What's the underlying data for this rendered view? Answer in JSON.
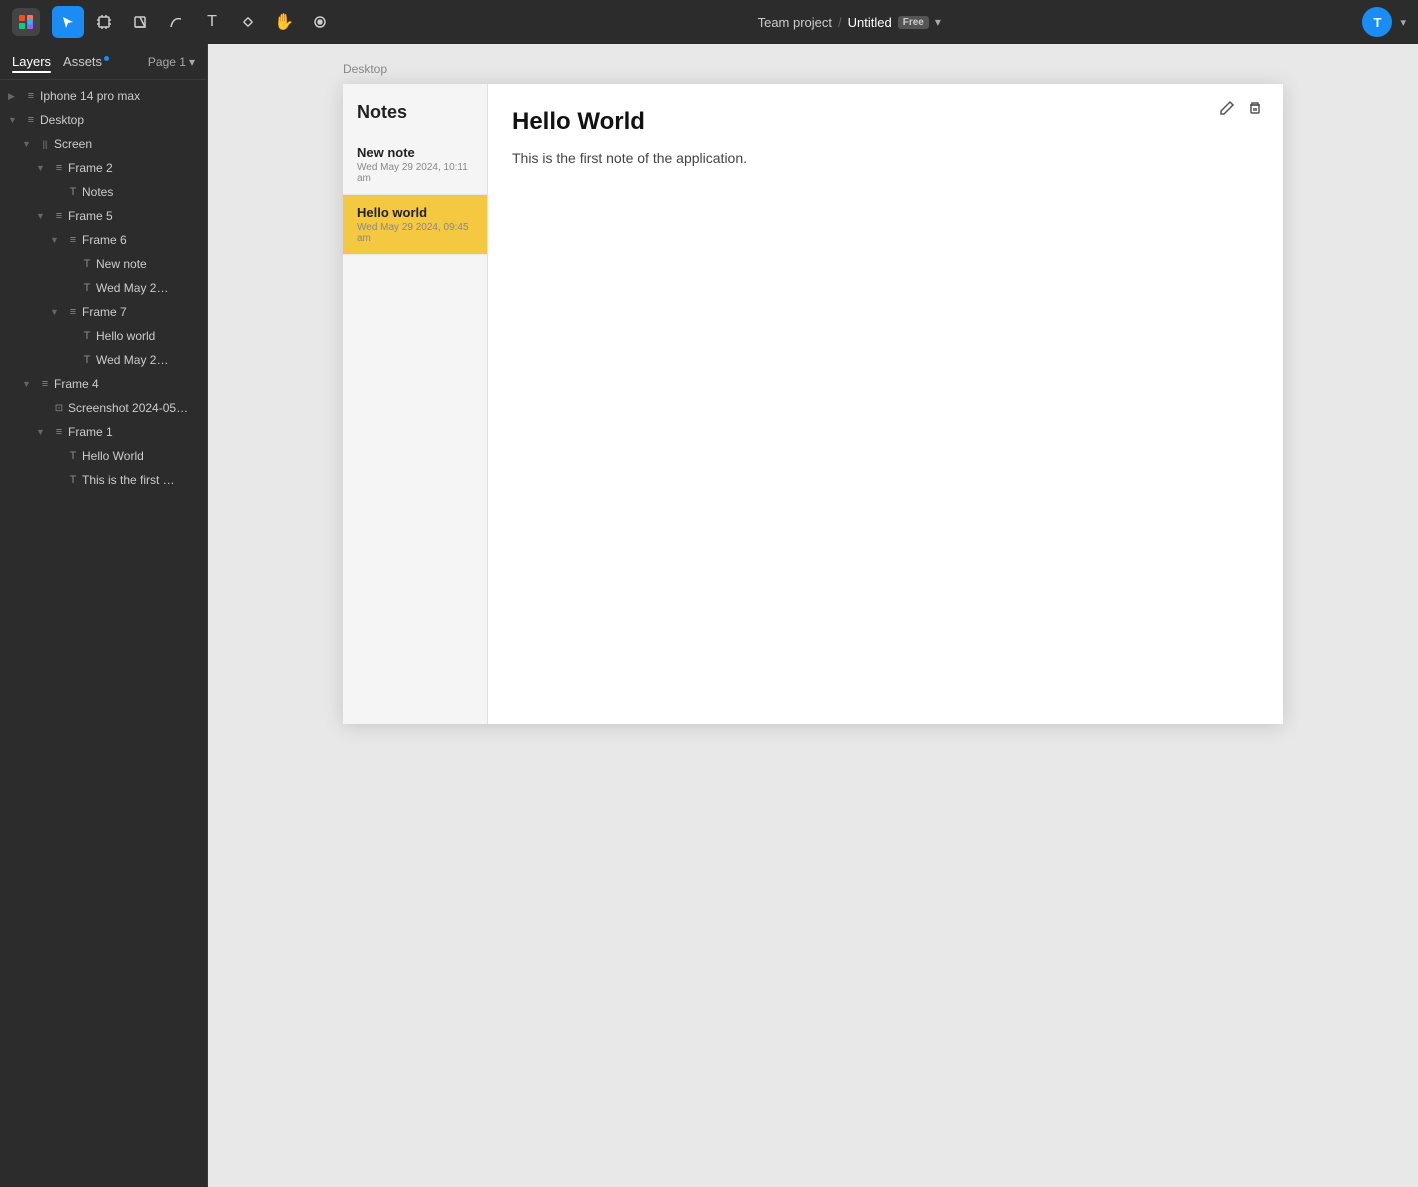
{
  "topbar": {
    "logo_icon": "figma-icon",
    "tools": [
      {
        "id": "select",
        "label": "Select",
        "icon": "▶",
        "active": true
      },
      {
        "id": "frame",
        "label": "Frame",
        "icon": "⊞",
        "active": false
      },
      {
        "id": "shape",
        "label": "Shape",
        "icon": "□",
        "active": false
      },
      {
        "id": "vector",
        "label": "Vector",
        "icon": "✏",
        "active": false
      },
      {
        "id": "text",
        "label": "Text",
        "icon": "T",
        "active": false
      },
      {
        "id": "component",
        "label": "Component",
        "icon": "❖",
        "active": false
      },
      {
        "id": "hand",
        "label": "Hand",
        "icon": "✋",
        "active": false
      },
      {
        "id": "comment",
        "label": "Comment",
        "icon": "○",
        "active": false
      }
    ],
    "project_name": "Team project",
    "separator": "/",
    "file_name": "Untitled",
    "badge": "Free",
    "dropdown_icon": "▾",
    "avatar_initial": "T"
  },
  "sidebar": {
    "tabs": [
      {
        "id": "layers",
        "label": "Layers",
        "active": true
      },
      {
        "id": "assets",
        "label": "Assets",
        "has_dot": true,
        "active": false
      }
    ],
    "page_label": "Page 1",
    "layers": [
      {
        "id": "iphone",
        "label": "Iphone 14 pro max",
        "indent": 0,
        "icon": "≡",
        "type": "frame",
        "expanded": false
      },
      {
        "id": "desktop",
        "label": "Desktop",
        "indent": 0,
        "icon": "≡",
        "type": "frame",
        "expanded": true
      },
      {
        "id": "screen",
        "label": "Screen",
        "indent": 1,
        "icon": "≡",
        "type": "group",
        "expanded": true
      },
      {
        "id": "frame2",
        "label": "Frame 2",
        "indent": 2,
        "icon": "≡",
        "type": "frame",
        "expanded": true
      },
      {
        "id": "notes",
        "label": "Notes",
        "indent": 3,
        "icon": "T",
        "type": "text"
      },
      {
        "id": "frame5",
        "label": "Frame 5",
        "indent": 2,
        "icon": "≡",
        "type": "frame",
        "expanded": true
      },
      {
        "id": "frame6",
        "label": "Frame 6",
        "indent": 3,
        "icon": "≡",
        "type": "frame",
        "expanded": true
      },
      {
        "id": "newnote",
        "label": "New note",
        "indent": 4,
        "icon": "T",
        "type": "text"
      },
      {
        "id": "wedmay1",
        "label": "Wed May 2…",
        "indent": 4,
        "icon": "T",
        "type": "text"
      },
      {
        "id": "frame7",
        "label": "Frame 7",
        "indent": 3,
        "icon": "≡",
        "type": "frame",
        "expanded": true
      },
      {
        "id": "helloworld_lower",
        "label": "Hello world",
        "indent": 4,
        "icon": "T",
        "type": "text"
      },
      {
        "id": "wedmay2",
        "label": "Wed May 2…",
        "indent": 4,
        "icon": "T",
        "type": "text"
      },
      {
        "id": "frame4",
        "label": "Frame 4",
        "indent": 1,
        "icon": "≡",
        "type": "frame",
        "expanded": true
      },
      {
        "id": "screenshot",
        "label": "Screenshot 2024-05…",
        "indent": 2,
        "icon": "⊡",
        "type": "image"
      },
      {
        "id": "frame1",
        "label": "Frame 1",
        "indent": 2,
        "icon": "≡",
        "type": "frame",
        "expanded": true
      },
      {
        "id": "helloworld_cap",
        "label": "Hello World",
        "indent": 3,
        "icon": "T",
        "type": "text"
      },
      {
        "id": "firstnote",
        "label": "This is the first …",
        "indent": 3,
        "icon": "T",
        "type": "text"
      }
    ]
  },
  "canvas": {
    "frame_label": "Desktop",
    "notes_app": {
      "sidebar_title": "Notes",
      "notes": [
        {
          "id": "new-note",
          "title": "New note",
          "date": "Wed May 29 2024, 10:11 am",
          "selected": false
        },
        {
          "id": "hello-world",
          "title": "Hello world",
          "date": "Wed May 29 2024, 09:45 am",
          "selected": true
        }
      ],
      "detail": {
        "title": "Hello World",
        "body": "This is the first note of the application.",
        "edit_icon": "✎",
        "delete_icon": "🗑"
      }
    }
  }
}
